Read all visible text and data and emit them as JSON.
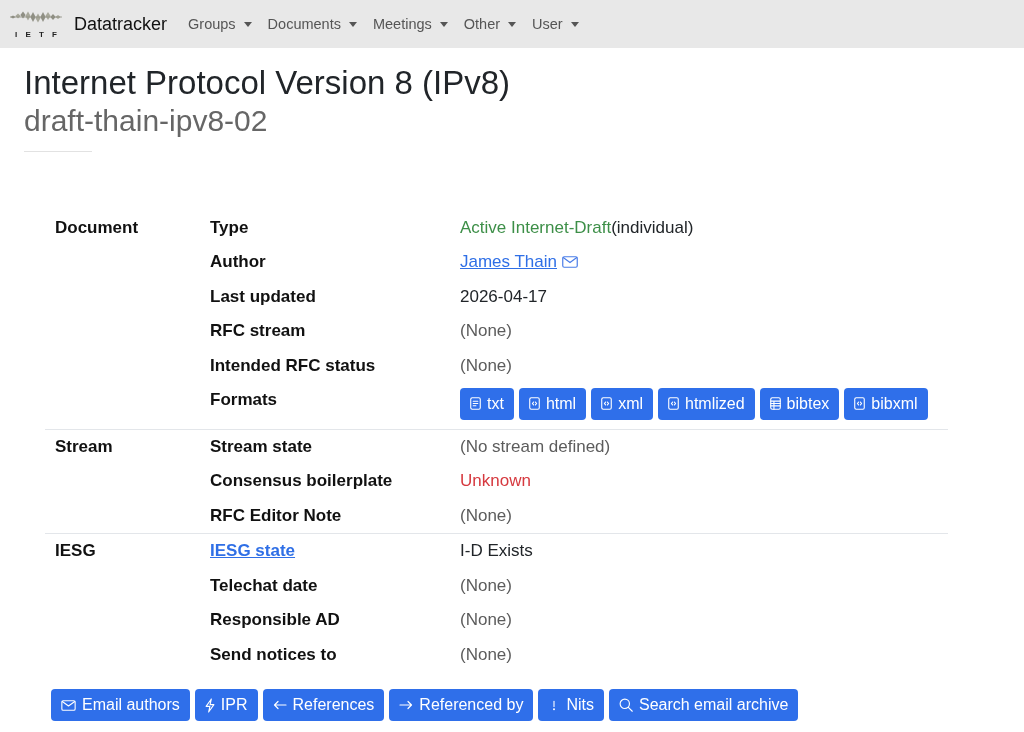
{
  "navbar": {
    "logo_text": "I E T F",
    "brand": "Datatracker",
    "menus": [
      {
        "label": "Groups"
      },
      {
        "label": "Documents"
      },
      {
        "label": "Meetings"
      },
      {
        "label": "Other"
      },
      {
        "label": "User"
      }
    ]
  },
  "document": {
    "title": "Internet Protocol Version 8 (IPv8)",
    "name": "draft-thain-ipv8-02"
  },
  "sections": [
    {
      "heading": "Document",
      "rows": [
        {
          "label": "Type",
          "label_link": false,
          "kind": "state",
          "value": "Active Internet-Draft",
          "color": "#3d8f48",
          "note": "(individual)"
        },
        {
          "label": "Author",
          "label_link": false,
          "kind": "person",
          "value": "James Thain"
        },
        {
          "label": "Last updated",
          "label_link": false,
          "kind": "text",
          "value": "2026-04-17"
        },
        {
          "label": "RFC stream",
          "label_link": false,
          "kind": "muted",
          "value": "(None)"
        },
        {
          "label": "Intended RFC status",
          "label_link": false,
          "kind": "muted",
          "value": "(None)"
        },
        {
          "label": "Formats",
          "label_link": false,
          "kind": "formats",
          "formats": [
            {
              "label": "txt",
              "kind": "text"
            },
            {
              "label": "html",
              "kind": "code"
            },
            {
              "label": "xml",
              "kind": "code"
            },
            {
              "label": "htmlized",
              "kind": "code"
            },
            {
              "label": "bibtex",
              "kind": "table"
            },
            {
              "label": "bibxml",
              "kind": "code"
            }
          ]
        }
      ]
    },
    {
      "heading": "Stream",
      "rows": [
        {
          "label": "Stream state",
          "label_link": false,
          "kind": "muted",
          "value": "(No stream defined)"
        },
        {
          "label": "Consensus boilerplate",
          "label_link": false,
          "kind": "state",
          "value": "Unknown",
          "color": "#d6393f"
        },
        {
          "label": "RFC Editor Note",
          "label_link": false,
          "kind": "muted",
          "value": "(None)"
        }
      ]
    },
    {
      "heading": "IESG",
      "rows": [
        {
          "label": "IESG state",
          "label_link": true,
          "kind": "text",
          "value": "I-D Exists"
        },
        {
          "label": "Telechat date",
          "label_link": false,
          "kind": "muted",
          "value": "(None)"
        },
        {
          "label": "Responsible AD",
          "label_link": false,
          "kind": "muted",
          "value": "(None)"
        },
        {
          "label": "Send notices to",
          "label_link": false,
          "kind": "muted",
          "value": "(None)"
        }
      ]
    }
  ],
  "actions": [
    {
      "label": "Email authors",
      "kind": "email"
    },
    {
      "label": "IPR",
      "kind": "ipr"
    },
    {
      "label": "References",
      "kind": "references"
    },
    {
      "label": "Referenced by",
      "kind": "referenced-by"
    },
    {
      "label": "Nits",
      "kind": "nits"
    },
    {
      "label": "Search email archive",
      "kind": "search"
    }
  ]
}
